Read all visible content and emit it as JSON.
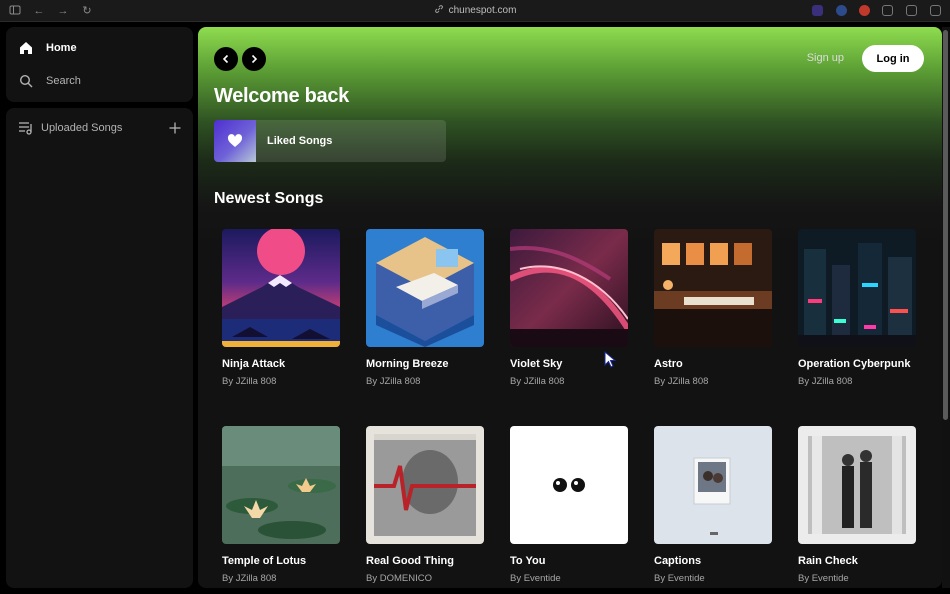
{
  "browser": {
    "url": "chunespot.com"
  },
  "sidebar": {
    "home_label": "Home",
    "search_label": "Search",
    "library_label": "Uploaded Songs"
  },
  "header": {
    "signup_label": "Sign up",
    "login_label": "Log in"
  },
  "main": {
    "welcome": "Welcome back",
    "liked_label": "Liked Songs",
    "section_title": "Newest Songs"
  },
  "songs": [
    {
      "title": "Ninja Attack",
      "artist": "By JZilla 808"
    },
    {
      "title": "Morning Breeze",
      "artist": "By JZilla 808"
    },
    {
      "title": "Violet Sky",
      "artist": "By JZilla 808"
    },
    {
      "title": "Astro",
      "artist": "By JZilla 808"
    },
    {
      "title": "Operation Cyberpunk",
      "artist": "By JZilla 808"
    },
    {
      "title": "Temple of Lotus",
      "artist": "By JZilla 808"
    },
    {
      "title": "Real Good Thing",
      "artist": "By DOMENICO"
    },
    {
      "title": "To You",
      "artist": "By Eventide"
    },
    {
      "title": "Captions",
      "artist": "By Eventide"
    },
    {
      "title": "Rain Check",
      "artist": "By Eventide"
    }
  ],
  "colors": {
    "accent_green": "#8fdc4f",
    "surface": "#121212",
    "muted_text": "#a7a7a7"
  }
}
